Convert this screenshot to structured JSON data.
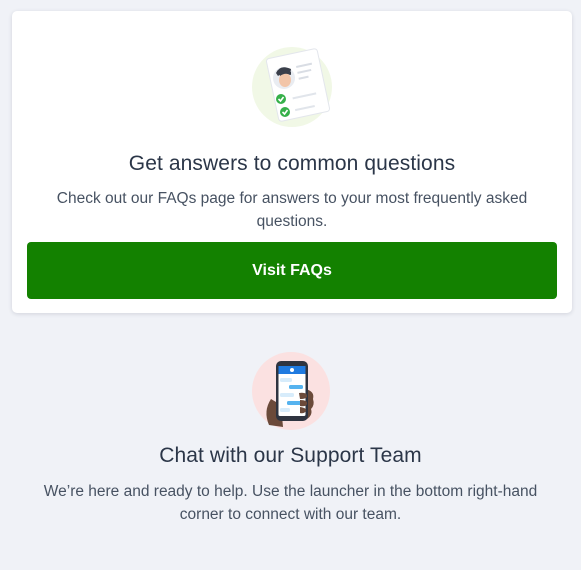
{
  "faq": {
    "title": "Get answers to common questions",
    "description": "Check out our FAQs page for answers to your most frequently asked questions.",
    "button_label": "Visit FAQs",
    "illustration": "profile-checklist-illustration",
    "button_color": "#138100"
  },
  "support": {
    "title": "Chat with our Support Team",
    "description": "We’re here and ready to help. Use the launcher in the bottom right-hand corner to connect with our team.",
    "illustration": "phone-chat-illustration"
  }
}
